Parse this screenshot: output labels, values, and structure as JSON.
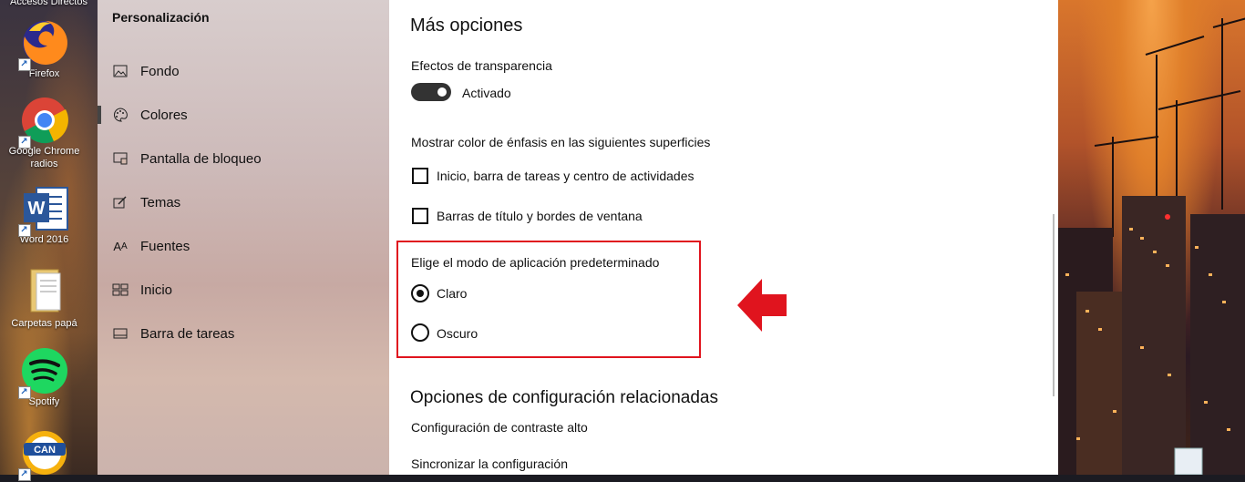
{
  "desktop": {
    "top_label": "Accesos Directos",
    "icons": [
      {
        "name": "Firefox",
        "icon": "firefox-icon"
      },
      {
        "name": "Google Chrome radios",
        "line1": "Google Chrome",
        "line2": "radios",
        "icon": "chrome-icon"
      },
      {
        "name": "Word 2016",
        "icon": "word-icon"
      },
      {
        "name": "Carpetas papá",
        "icon": "folder-icon"
      },
      {
        "name": "Spotify",
        "icon": "spotify-icon"
      },
      {
        "name": "CAN",
        "icon": "can-icon"
      }
    ]
  },
  "nav": {
    "title": "Personalización",
    "items": [
      {
        "label": "Fondo",
        "icon": "picture-icon"
      },
      {
        "label": "Colores",
        "icon": "palette-icon",
        "active": true
      },
      {
        "label": "Pantalla de bloqueo",
        "icon": "lock-screen-icon"
      },
      {
        "label": "Temas",
        "icon": "brush-icon"
      },
      {
        "label": "Fuentes",
        "icon": "font-icon"
      },
      {
        "label": "Inicio",
        "icon": "start-icon"
      },
      {
        "label": "Barra de tareas",
        "icon": "taskbar-icon"
      }
    ]
  },
  "content": {
    "more_options_heading": "Más opciones",
    "transparency_label": "Efectos de transparencia",
    "transparency_state": "Activado",
    "accent_surfaces_label": "Mostrar color de énfasis en las siguientes superficies",
    "checkbox_start": "Inicio, barra de tareas y centro de actividades",
    "checkbox_titlebars": "Barras de título y bordes de ventana",
    "app_mode_label": "Elige el modo de aplicación predeterminado",
    "radio_light": "Claro",
    "radio_dark": "Oscuro",
    "related_heading": "Opciones de configuración relacionadas",
    "link_contrast": "Configuración de contraste alto",
    "link_sync": "Sincronizar la configuración"
  },
  "colors": {
    "accent_red": "#e0141e"
  }
}
